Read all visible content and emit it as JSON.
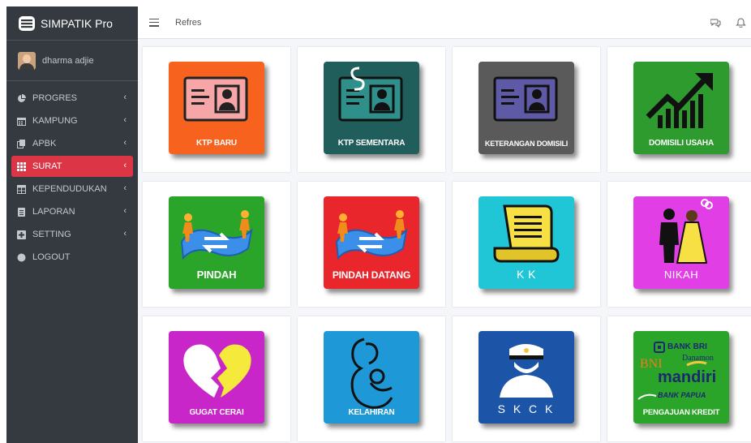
{
  "brand": {
    "title": "SIMPATIK Pro"
  },
  "user": {
    "name": "dharma adjie"
  },
  "nav": [
    {
      "label": "PROGRES",
      "icon": "pie-chart-icon",
      "active": false
    },
    {
      "label": "KAMPUNG",
      "icon": "calendar-icon",
      "active": false
    },
    {
      "label": "APBK",
      "icon": "copy-icon",
      "active": false
    },
    {
      "label": "SURAT",
      "icon": "grid-icon",
      "active": true
    },
    {
      "label": "KEPENDUDUKAN",
      "icon": "table-icon",
      "active": false
    },
    {
      "label": "LAPORAN",
      "icon": "document-icon",
      "active": false
    },
    {
      "label": "SETTING",
      "icon": "plus-square-icon",
      "active": false
    },
    {
      "label": "LOGOUT",
      "icon": "circle-icon",
      "active": false
    }
  ],
  "topbar": {
    "refresh_label": "Refres"
  },
  "colors": {
    "sidebar": "#343a40",
    "active": "#dc3545",
    "content_bg": "#f4f6f9"
  },
  "tiles": [
    {
      "label": "KTP BARU",
      "color": "#f7631f",
      "icon": "id-card-icon"
    },
    {
      "label": "KTP SEMENTARA",
      "color": "#1f5e5a",
      "icon": "temporary-id-card-icon"
    },
    {
      "label": "KETERANGAN DOMISILI",
      "color": "#5a5a5a",
      "icon": "id-card-icon"
    },
    {
      "label": "DOMISILI USAHA",
      "color": "#2e9b2e",
      "icon": "growth-chart-icon"
    },
    {
      "label": "PINDAH",
      "color": "#2aa52a",
      "icon": "relocation-icon"
    },
    {
      "label": "PINDAH DATANG",
      "color": "#e8262b",
      "icon": "relocation-icon"
    },
    {
      "label": "K K",
      "color": "#21c6d6",
      "icon": "scroll-icon"
    },
    {
      "label": "NIKAH",
      "color": "#e23ee6",
      "icon": "wedding-couple-icon"
    },
    {
      "label": "GUGAT CERAI",
      "color": "#c826c8",
      "icon": "broken-heart-icon"
    },
    {
      "label": "KELAHIRAN",
      "color": "#1e98d6",
      "icon": "mother-baby-icon"
    },
    {
      "label": "S K C K",
      "color": "#1c54a8",
      "icon": "police-icon"
    },
    {
      "label": "PENGAJUAN KREDIT",
      "color": "#2aa52a",
      "icon": "bank-logos-icon"
    }
  ],
  "bank_logos": {
    "bri": "BANK BRI",
    "bni": "BNI",
    "danamon": "Danamon",
    "mandiri": "mandiri",
    "papua": "BANK PAPUA"
  }
}
